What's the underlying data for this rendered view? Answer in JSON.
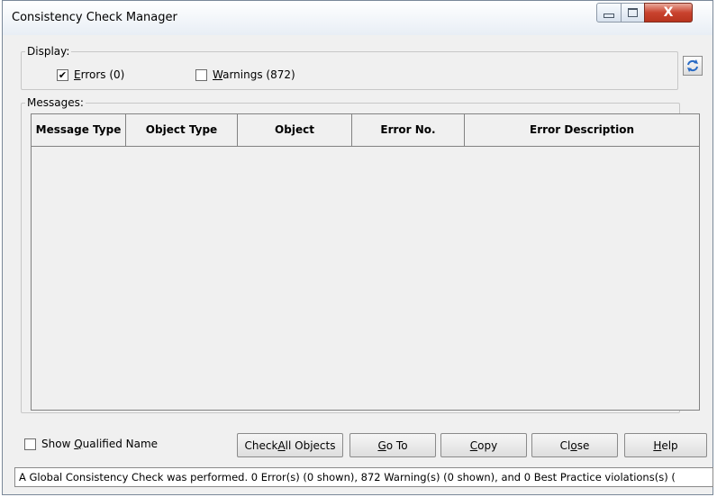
{
  "window": {
    "title": "Consistency Check Manager",
    "close_glyph": "X"
  },
  "display": {
    "legend": "Display:",
    "errors": {
      "checked": true,
      "label_mnemonic": "E",
      "label_rest": "rrors (0)"
    },
    "warnings": {
      "checked": false,
      "label_mnemonic": "W",
      "label_rest": "arnings (872)"
    }
  },
  "messages": {
    "legend": "Messages:",
    "columns": [
      "Message Type",
      "Object Type",
      "Object",
      "Error No.",
      "Error Description"
    ],
    "rows": []
  },
  "options": {
    "show_qualified_name": {
      "checked": false,
      "label_before": "Show ",
      "label_mnemonic": "Q",
      "label_rest": "ualified Name"
    }
  },
  "buttons": {
    "check_all": {
      "before": "Check ",
      "mnemonic": "A",
      "rest": "ll Objects"
    },
    "goto": {
      "before": "",
      "mnemonic": "G",
      "rest": "o To"
    },
    "copy": {
      "before": "",
      "mnemonic": "C",
      "rest": "opy"
    },
    "close": {
      "before": "Cl",
      "mnemonic": "o",
      "rest": "se"
    },
    "help": {
      "before": "",
      "mnemonic": "H",
      "rest": "elp"
    }
  },
  "status_text": "A Global Consistency Check was performed. 0 Error(s) (0 shown), 872 Warning(s) (0 shown), and 0 Best Practice violations(s) (",
  "icons": {
    "refresh": "refresh-icon",
    "check": "check-icon"
  },
  "colors": {
    "close_button": "#c9432e",
    "window_bg": "#f0f0f0",
    "accent_blue": "#2a6bc4"
  }
}
